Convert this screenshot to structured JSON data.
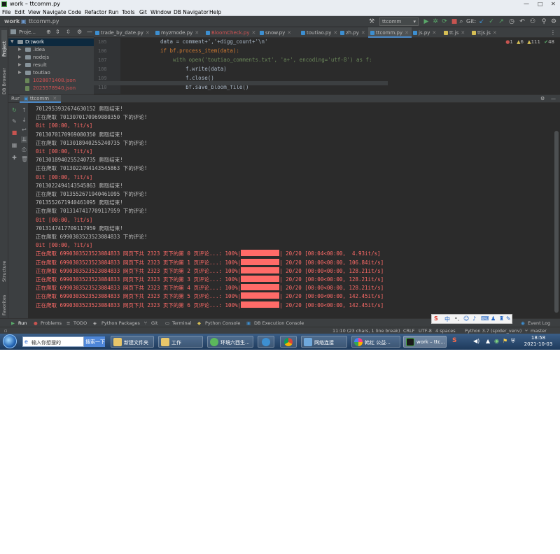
{
  "window": {
    "title": "work – ttcomm.py",
    "controls": [
      "—",
      "□",
      "✕"
    ]
  },
  "menu": [
    "File",
    "Edit",
    "View",
    "Navigate",
    "Code",
    "Refactor",
    "Run",
    "Tools",
    "Git",
    "Window",
    "DB Navigator",
    "Help"
  ],
  "navbar": {
    "project": "work",
    "file": "ttcomm.py",
    "run_config": "ttcomm",
    "git_label": "Git:"
  },
  "sidebar": {
    "strip_project": "Project",
    "strip_db": "DB Browser",
    "strip_structure": "Structure",
    "strip_favorites": "Favorites",
    "panel_title": "Proje...",
    "root": "D:\\work",
    "items": [
      ".idea",
      "nodejs",
      "result",
      "toutiao",
      "1028871408.json",
      "2025578940.json"
    ]
  },
  "editor_tabs": [
    "trade_by_date.py",
    "myzmode.py",
    "BloomCheck.py",
    "snow.py",
    "toutiao.py",
    "zh.py",
    "ttcomm.py",
    "js.py",
    "tt.js",
    "ttjs.js"
  ],
  "editor": {
    "line_numbers": [
      "105",
      "106",
      "107",
      "108",
      "109",
      "110"
    ],
    "lines": [
      "data = comment+','+digg_count+'\\n'",
      "if bf.process_item(data):",
      "    with open('toutiao_comments.txt', 'a+', encoding='utf-8') as f:",
      "        f.write(data)",
      "        f.close()",
      "        bf.save_bloom_file()"
    ],
    "inspections": {
      "errors": "1",
      "warnings": "6",
      "weak": "111",
      "typos": "48"
    }
  },
  "run": {
    "label": "Run:",
    "tab": "ttcomm"
  },
  "console_lines": [
    {
      "type": "norm",
      "text": "7012953932674630152 爬取结束!"
    },
    {
      "type": "norm",
      "text": "正在爬取 7013070170969080350 下的评论!"
    },
    {
      "type": "err",
      "text": "0it [00:00, ?it/s]"
    },
    {
      "type": "norm",
      "text": "7013070170969080350 爬取结束!"
    },
    {
      "type": "norm",
      "text": "正在爬取 7013018940255240735 下的评论!"
    },
    {
      "type": "err",
      "text": "0it [00:00, ?it/s]"
    },
    {
      "type": "norm",
      "text": "7013018940255240735 爬取结束!"
    },
    {
      "type": "norm",
      "text": "正在爬取 7013022494143545863 下的评论!"
    },
    {
      "type": "err",
      "text": "0it [00:00, ?it/s]"
    },
    {
      "type": "norm",
      "text": "7013022494143545863 爬取结束!"
    },
    {
      "type": "norm",
      "text": "正在爬取 7013552671940461095 下的评论!"
    },
    {
      "type": "norm",
      "text": "7013552671940461095 爬取结束!"
    },
    {
      "type": "norm",
      "text": "正在爬取 7013147417709117959 下的评论!"
    },
    {
      "type": "err",
      "text": "0it [00:00, ?it/s]"
    },
    {
      "type": "norm",
      "text": "7013147417709117959 爬取结束!"
    },
    {
      "type": "norm",
      "text": "正在爬取 6990303523523084833 下的评论!"
    },
    {
      "type": "err",
      "text": "0it [00:00, ?it/s]"
    }
  ],
  "progress_lines": [
    {
      "prefix": "正在爬取 6990303523523084833 网页下共 2323 页下的第 0 页评论...: 100%|",
      "suffix": "| 20/20 [00:04<00:00,  4.93it/s]"
    },
    {
      "prefix": "正在爬取 6990303523523084833 网页下共 2323 页下的第 1 页评论...: 100%|",
      "suffix": "| 20/20 [00:00<00:00, 106.84it/s]"
    },
    {
      "prefix": "正在爬取 6990303523523084833 网页下共 2323 页下的第 2 页评论...: 100%|",
      "suffix": "| 20/20 [00:00<00:00, 128.21it/s]"
    },
    {
      "prefix": "正在爬取 6990303523523084833 网页下共 2323 页下的第 3 页评论...: 100%|",
      "suffix": "| 20/20 [00:00<00:00, 128.21it/s]"
    },
    {
      "prefix": "正在爬取 6990303523523084833 网页下共 2323 页下的第 4 页评论...: 100%|",
      "suffix": "| 20/20 [00:00<00:00, 128.21it/s]"
    },
    {
      "prefix": "正在爬取 6990303523523084833 网页下共 2323 页下的第 5 页评论...: 100%|",
      "suffix": "| 20/20 [00:00<00:00, 142.45it/s]"
    },
    {
      "prefix": "正在爬取 6990303523523084833 网页下共 2323 页下的第 6 页评论...: 100%|",
      "suffix": "| 20/20 [00:00<00:00, 142.45it/s]"
    }
  ],
  "bottom_tabs": [
    "Run",
    "Problems",
    "TODO",
    "Python Packages",
    "Git",
    "Terminal",
    "Python Console",
    "DB Execution Console"
  ],
  "event_log": "Event Log",
  "status": {
    "position": "11:10 (23 chars, 1 line break)",
    "line_sep": "CRLF",
    "encoding": "UTF-8",
    "indent": "4 spaces",
    "interpreter": "Python 3.7 (spider_venv)",
    "branch": "master"
  },
  "ime": {
    "lang": "中"
  },
  "taskbar": {
    "search_placeholder": "输入你想搜的",
    "search_button": "搜索一下",
    "items": [
      "新建文件夹",
      "工作",
      "环境六西生...",
      "",
      "",
      "网络连接",
      "韩红 公益...",
      "work – ttc..."
    ],
    "time": "18:58",
    "date": "2021-10-03"
  }
}
